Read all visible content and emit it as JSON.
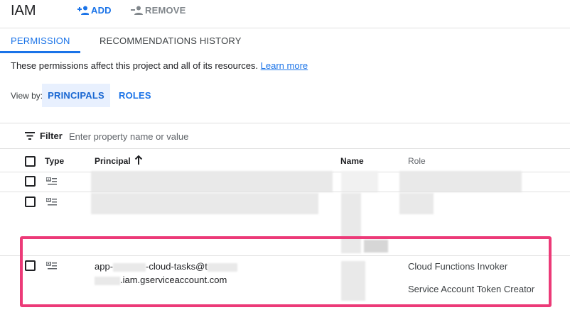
{
  "header": {
    "title": "IAM",
    "add_label": "ADD",
    "remove_label": "REMOVE"
  },
  "tabs": [
    {
      "label": "PERMISSION",
      "active": true
    },
    {
      "label": "RECOMMENDATIONS HISTORY",
      "active": false
    }
  ],
  "description": {
    "text": "These permissions affect this project and all of its resources.",
    "link": "Learn more"
  },
  "view_by": {
    "label": "View by:",
    "options": [
      "PRINCIPALS",
      "ROLES"
    ],
    "selected": "PRINCIPALS"
  },
  "filter": {
    "label": "Filter",
    "placeholder": "Enter property name or value"
  },
  "table": {
    "columns": [
      "Type",
      "Principal",
      "Name",
      "Role"
    ],
    "sort_icon": "arrow-up-icon",
    "rows": [
      {
        "type_icon": "service-account-icon",
        "principal": "",
        "name": "",
        "roles": []
      },
      {
        "type_icon": "service-account-icon",
        "principal": "",
        "name": "",
        "roles": []
      },
      {
        "type_icon": "service-account-icon",
        "principal_line1_start": "app-",
        "principal_line1_mid": "-cloud-tasks@t",
        "principal_line2": ".iam.gserviceaccount.com",
        "roles": [
          "Cloud Functions Invoker",
          "Service Account Token Creator"
        ],
        "highlighted": true
      }
    ]
  },
  "colors": {
    "accent": "#1a73e8",
    "highlight": "#ec3a78",
    "selected_bg": "#e8f0fe"
  }
}
